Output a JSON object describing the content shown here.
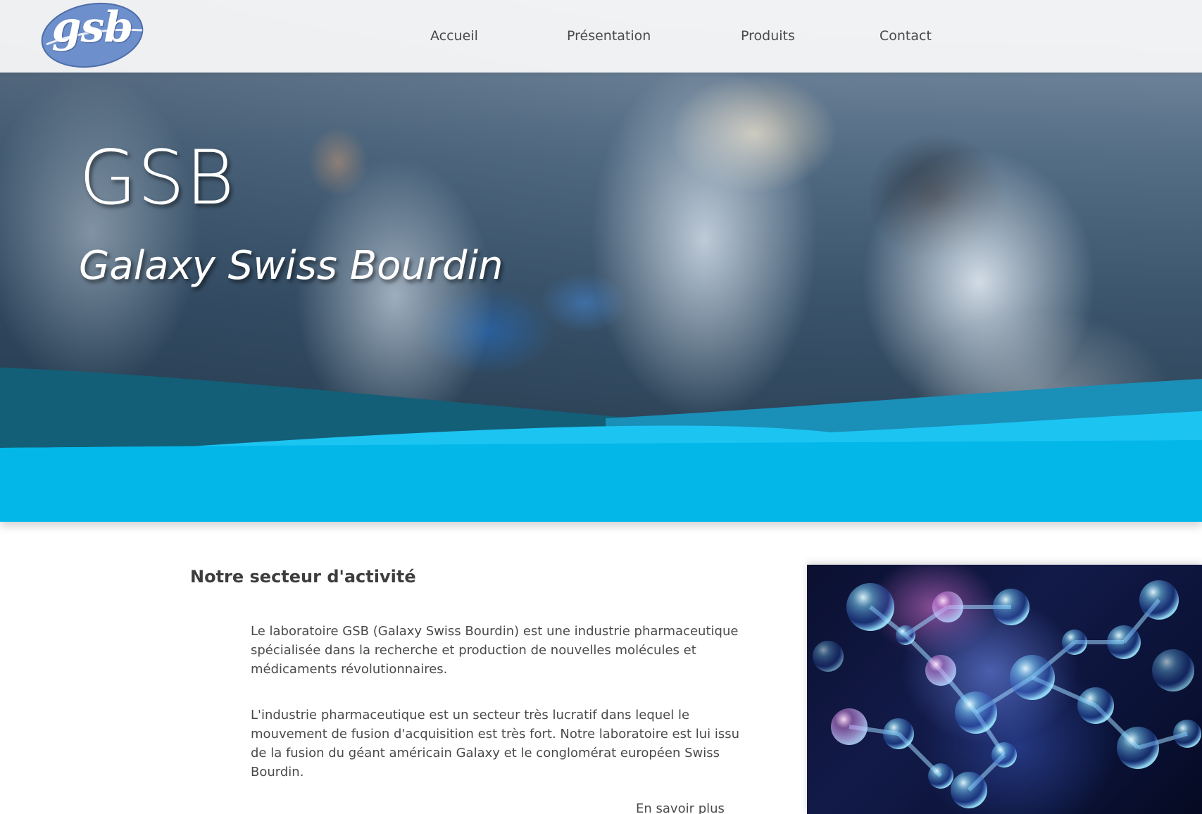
{
  "navbar": {
    "logo_text": "gsb",
    "links": [
      {
        "label": "Accueil"
      },
      {
        "label": "Présentation"
      },
      {
        "label": "Produits"
      },
      {
        "label": "Contact"
      }
    ]
  },
  "hero": {
    "title": "GSB",
    "subtitle": "Galaxy Swiss Bourdin"
  },
  "content": {
    "section_title": "Notre secteur d'activité",
    "paragraph_1": "Le laboratoire GSB (Galaxy Swiss Bourdin) est une industrie pharmaceutique spécialisée dans la recherche et production de nouvelles molécules et médicaments révolutionnaires.",
    "paragraph_2": "L'industrie pharmaceutique est un secteur très lucratif dans lequel le mouvement de fusion d'acquisition est très fort. Notre laboratoire est lui issu de la fusion du géant américain Galaxy et le conglomérat européen Swiss Bourdin.",
    "more_link": "En savoir plus"
  },
  "colors": {
    "accent_cyan": "#03b7e9",
    "wave_dark_teal": "#135f78",
    "wave_mid": "#1a8fb8",
    "logo_blue": "#6d8fcc"
  },
  "icons": {
    "logo": "gsb-logo",
    "illustration": "molecule-illustration"
  }
}
